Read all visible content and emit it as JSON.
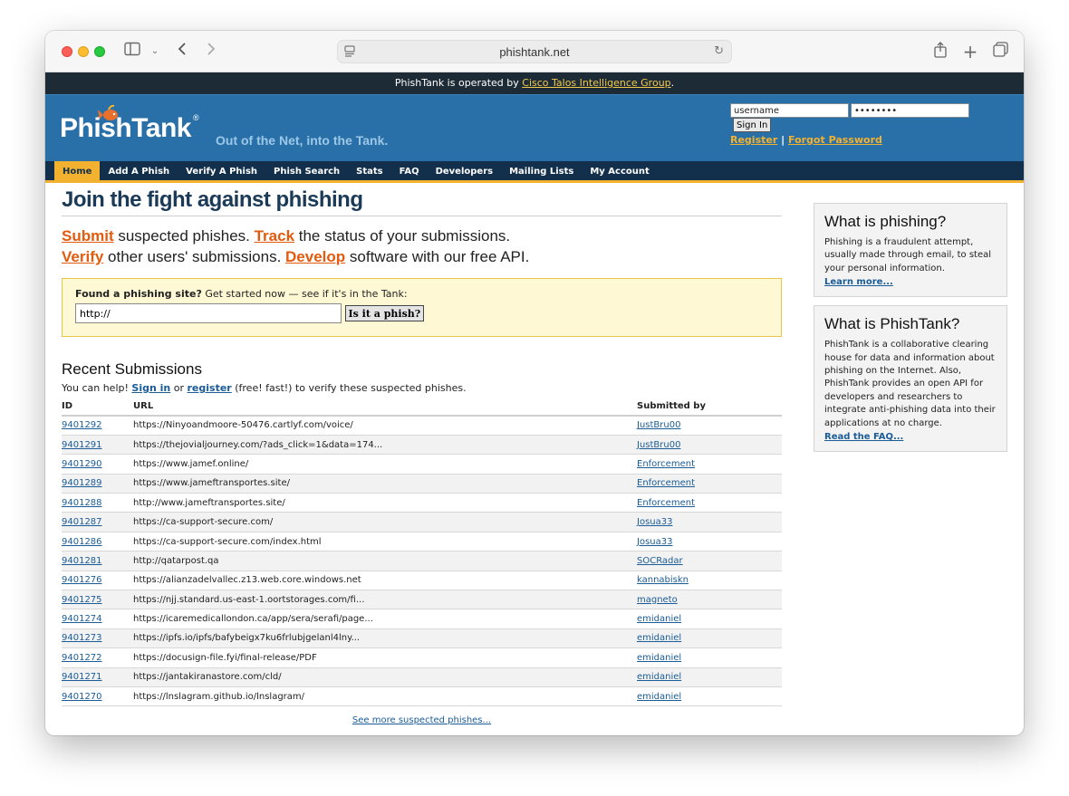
{
  "browser": {
    "url": "phishtank.net"
  },
  "operator_bar": {
    "prefix": "PhishTank is operated by ",
    "link": "Cisco Talos Intelligence Group",
    "suffix": "."
  },
  "header": {
    "logo": "PhishTank",
    "logo_reg": "®",
    "tagline": "Out of the Net, into the Tank.",
    "login": {
      "username_value": "username",
      "password_value": "••••••••",
      "signin_label": "Sign In",
      "register_label": "Register",
      "separator": "|",
      "forgot_label": "Forgot Password"
    }
  },
  "nav": {
    "items": [
      {
        "label": "Home",
        "active": true
      },
      {
        "label": "Add A Phish"
      },
      {
        "label": "Verify A Phish"
      },
      {
        "label": "Phish Search"
      },
      {
        "label": "Stats"
      },
      {
        "label": "FAQ"
      },
      {
        "label": "Developers"
      },
      {
        "label": "Mailing Lists"
      },
      {
        "label": "My Account"
      }
    ]
  },
  "main": {
    "title": "Join the fight against phishing",
    "intro": {
      "submit": "Submit",
      "submit_text": " suspected phishes. ",
      "track": "Track",
      "track_text": " the status of your submissions.",
      "verify": "Verify",
      "verify_text": " other users' submissions. ",
      "develop": "Develop",
      "develop_text": " software with our free API."
    },
    "find": {
      "label_bold": "Found a phishing site?",
      "label_rest": " Get started now — see if it's in the Tank:",
      "input_value": "http://",
      "button_label": "Is it a phish?"
    },
    "recent": {
      "title": "Recent Submissions",
      "help_prefix": "You can help! ",
      "signin": "Sign in",
      "help_or": " or ",
      "register": "register",
      "help_suffix": " (free! fast!) to verify these suspected phishes.",
      "columns": [
        "ID",
        "URL",
        "Submitted by"
      ],
      "rows": [
        {
          "id": "9401292",
          "url": "https://Ninyoandmoore-50476.cartlyf.com/voice/",
          "by": "JustBru00"
        },
        {
          "id": "9401291",
          "url": "https://thejovialjourney.com/?ads_click=1&data=174...",
          "by": "JustBru00"
        },
        {
          "id": "9401290",
          "url": "https://www.jamef.online/",
          "by": "Enforcement"
        },
        {
          "id": "9401289",
          "url": "https://www.jameftransportes.site/",
          "by": "Enforcement"
        },
        {
          "id": "9401288",
          "url": "http://www.jameftransportes.site/",
          "by": "Enforcement"
        },
        {
          "id": "9401287",
          "url": "https://ca-support-secure.com/",
          "by": "Josua33"
        },
        {
          "id": "9401286",
          "url": "https://ca-support-secure.com/index.html",
          "by": "Josua33"
        },
        {
          "id": "9401281",
          "url": "http://qatarpost.qa",
          "by": "SOCRadar"
        },
        {
          "id": "9401276",
          "url": "https://alianzadelvallec.z13.web.core.windows.net",
          "by": "kannabiskn"
        },
        {
          "id": "9401275",
          "url": "https://njj.standard.us-east-1.oortstorages.com/fi...",
          "by": "magneto"
        },
        {
          "id": "9401274",
          "url": "https://icaremedicallondon.ca/app/sera/serafi/page...",
          "by": "emidaniel"
        },
        {
          "id": "9401273",
          "url": "https://ipfs.io/ipfs/bafybeigx7ku6frlubjgelanl4lny...",
          "by": "emidaniel"
        },
        {
          "id": "9401272",
          "url": "https://docusign-file.fyi/final-release/PDF",
          "by": "emidaniel"
        },
        {
          "id": "9401271",
          "url": "https://jantakiranastore.com/cld/",
          "by": "emidaniel"
        },
        {
          "id": "9401270",
          "url": "https://lnslagram.github.io/lnslagram/",
          "by": "emidaniel"
        }
      ],
      "see_more": "See more suspected phishes..."
    }
  },
  "sidebar": {
    "what_is_phishing": {
      "title": "What is phishing?",
      "body": "Phishing is a fraudulent attempt, usually made through email, to steal your personal information.",
      "link": "Learn more..."
    },
    "what_is_phishtank": {
      "title": "What is PhishTank?",
      "body": "PhishTank is a collaborative clearing house for data and information about phishing on the Internet. Also, PhishTank provides an open API for developers and researchers to integrate anti-phishing data into their applications at no charge.",
      "link": "Read the FAQ..."
    }
  },
  "colors": {
    "header_blue": "#2a70a8",
    "nav_dark": "#12304c",
    "accent_gold": "#f2b230",
    "link_orange": "#e25b0e",
    "link_blue": "#1a5c97"
  }
}
